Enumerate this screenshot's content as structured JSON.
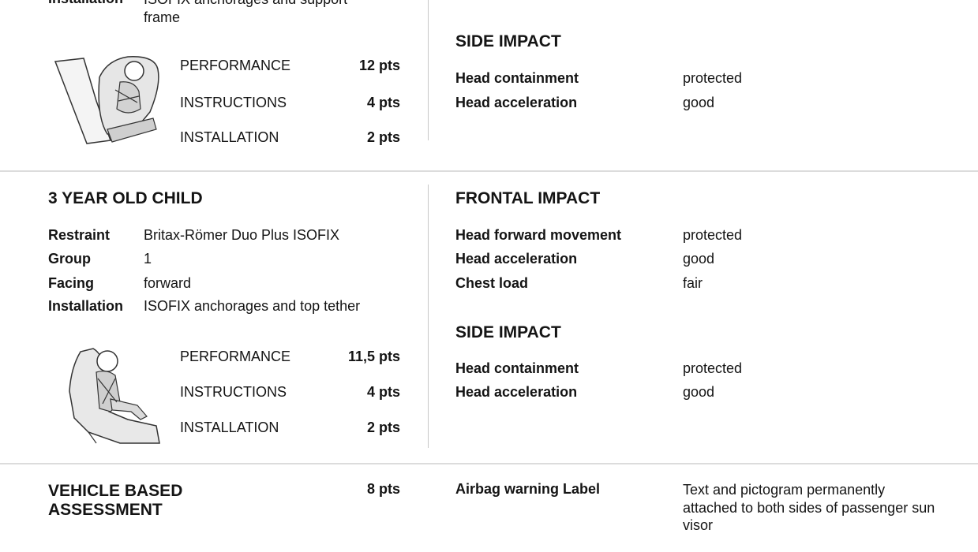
{
  "top_section": {
    "installation_label": "Installation",
    "installation_value": "ISOFIX anchorages and support frame",
    "performance_label": "PERFORMANCE",
    "performance_pts": "12 pts",
    "instructions_label": "INSTRUCTIONS",
    "instructions_pts": "4 pts",
    "installation_score_label": "INSTALLATION",
    "installation_pts": "2 pts",
    "side_impact": {
      "heading": "SIDE IMPACT",
      "rows": [
        {
          "label": "Head containment",
          "value": "protected"
        },
        {
          "label": "Head acceleration",
          "value": "good"
        }
      ]
    }
  },
  "child3": {
    "heading": "3 YEAR OLD CHILD",
    "details": [
      {
        "label": "Restraint",
        "value": "Britax-Römer Duo Plus ISOFIX"
      },
      {
        "label": "Group",
        "value": "1"
      },
      {
        "label": "Facing",
        "value": "forward"
      },
      {
        "label": "Installation",
        "value": "ISOFIX anchorages and top tether"
      }
    ],
    "scores": [
      {
        "label": "PERFORMANCE",
        "pts": "11,5 pts"
      },
      {
        "label": "INSTRUCTIONS",
        "pts": "4 pts"
      },
      {
        "label": "INSTALLATION",
        "pts": "2 pts"
      }
    ],
    "frontal_impact": {
      "heading": "FRONTAL IMPACT",
      "rows": [
        {
          "label": "Head forward movement",
          "value": "protected"
        },
        {
          "label": "Head acceleration",
          "value": "good"
        },
        {
          "label": "Chest load",
          "value": "fair"
        }
      ]
    },
    "side_impact": {
      "heading": "SIDE IMPACT",
      "rows": [
        {
          "label": "Head containment",
          "value": "protected"
        },
        {
          "label": "Head acceleration",
          "value": "good"
        }
      ]
    }
  },
  "vehicle": {
    "heading_line1": "VEHICLE BASED",
    "heading_line2": "ASSESSMENT",
    "pts": "8 pts",
    "airbag_label": "Airbag warning Label",
    "airbag_value": "Text and pictogram permanently attached to both sides of passenger sun visor"
  }
}
